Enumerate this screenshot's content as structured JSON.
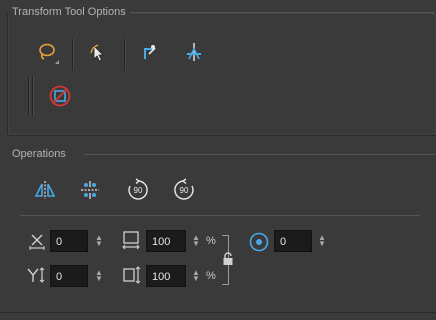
{
  "transform_tool_options": {
    "title": "Transform Tool Options",
    "tools": [
      {
        "name": "lasso-selection-tool",
        "icon": "lasso-icon",
        "active": true
      },
      {
        "name": "select-tool",
        "icon": "arrow-cursor-icon"
      },
      {
        "name": "pivot-tool-1",
        "icon": "pivot-star-icon"
      },
      {
        "name": "pivot-tool-2",
        "icon": "pivot-axis-icon"
      }
    ],
    "second_row": [
      {
        "name": "no-contour-tool",
        "icon": "prohibited-square-icon"
      }
    ]
  },
  "operations": {
    "title": "Operations",
    "buttons": [
      {
        "name": "flip-horizontal-button",
        "icon": "flip-horizontal-icon"
      },
      {
        "name": "flip-vertical-button",
        "icon": "flip-vertical-icon"
      },
      {
        "name": "rotate-90-cw-button",
        "icon": "rotate-90-cw-icon",
        "text": "90"
      },
      {
        "name": "rotate-90-ccw-button",
        "icon": "rotate-90-ccw-icon",
        "text": "90"
      }
    ],
    "x_value": "0",
    "y_value": "0",
    "width_value": "100",
    "height_value": "100",
    "percent_symbol": "%",
    "angle_value": "0"
  },
  "colors": {
    "accent_blue": "#4aa8e6",
    "lasso_orange": "#e9a23b",
    "prohibited_red": "#d13838"
  }
}
